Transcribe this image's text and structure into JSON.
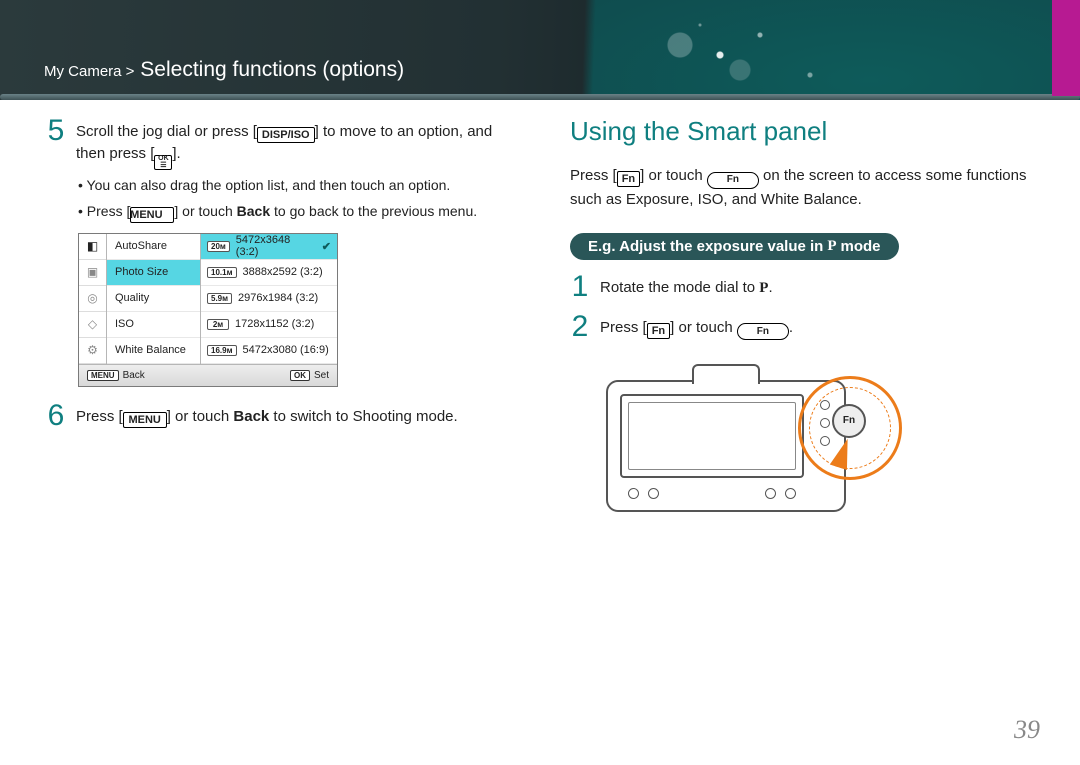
{
  "breadcrumb": {
    "root": "My Camera >",
    "title": "Selecting functions (options)"
  },
  "left": {
    "steps": {
      "5": {
        "num": "5",
        "body_a": "Scroll the jog dial or press [",
        "body_b": "] to move to an option, and then press [",
        "body_c": "].",
        "sub1": "You can also drag the option list, and then touch an option.",
        "sub2_a": "Press [",
        "sub2_b": "] or touch ",
        "sub2_c": "Back",
        "sub2_d": " to go back to the previous menu."
      },
      "6": {
        "num": "6",
        "body_a": "Press [",
        "body_b": "] or touch ",
        "body_c": "Back",
        "body_d": " to switch to Shooting mode."
      }
    },
    "icons": {
      "disp_iso": "DISP/ISO",
      "ok": {
        "top": "OK",
        "bot": "☰"
      },
      "menu": "MENU"
    },
    "menu": {
      "left_items": [
        "AutoShare",
        "Photo Size",
        "Quality",
        "ISO",
        "White Balance"
      ],
      "right_items": [
        {
          "badge": "20м",
          "label": "5472x3648 (3:2)",
          "selected": true
        },
        {
          "badge": "10.1м",
          "label": "3888x2592 (3:2)"
        },
        {
          "badge": "5.9м",
          "label": "2976x1984 (3:2)"
        },
        {
          "badge": "2м",
          "label": "1728x1152 (3:2)"
        },
        {
          "badge": "16.9м",
          "label": "5472x3080 (16:9)"
        }
      ],
      "foot_back_key": "MENU",
      "foot_back": "Back",
      "foot_set_key": "OK",
      "foot_set": "Set"
    }
  },
  "right": {
    "heading": "Using the Smart panel",
    "intro_a": "Press [",
    "intro_b": "] or touch ",
    "intro_c": " on the screen to access some functions such as Exposure, ISO, and White Balance.",
    "pill_a": "E.g. Adjust the exposure value in ",
    "pill_b": " mode",
    "steps": {
      "1": {
        "num": "1",
        "body_a": "Rotate the mode dial to ",
        "body_b": "."
      },
      "2": {
        "num": "2",
        "body_a": "Press [",
        "body_b": "] or touch ",
        "body_c": "."
      }
    },
    "icons": {
      "fn_bracket": "Fn",
      "fn_pill": "Fn",
      "mode_p": "P"
    },
    "camera_fn_label": "Fn"
  },
  "page_number": "39"
}
